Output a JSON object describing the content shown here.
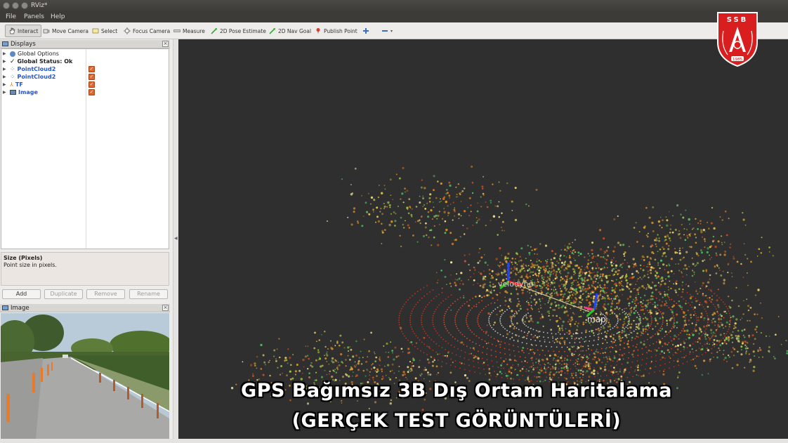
{
  "window": {
    "title": "RViz*"
  },
  "menu": {
    "items": [
      "File",
      "Panels",
      "Help"
    ]
  },
  "toolbar": {
    "tools": [
      {
        "label": "Interact",
        "icon": "hand-icon"
      },
      {
        "label": "Move Camera",
        "icon": "move-camera-icon"
      },
      {
        "label": "Select",
        "icon": "select-icon"
      },
      {
        "label": "Focus Camera",
        "icon": "focus-camera-icon"
      },
      {
        "label": "Measure",
        "icon": "ruler-icon"
      },
      {
        "label": "2D Pose Estimate",
        "icon": "green-arrow-icon"
      },
      {
        "label": "2D Nav Goal",
        "icon": "green-arrow-icon"
      },
      {
        "label": "Publish Point",
        "icon": "pin-icon"
      }
    ]
  },
  "displays_panel": {
    "title": "Displays",
    "items": [
      {
        "label": "Global Options",
        "style": "normal",
        "checked": false
      },
      {
        "label": "Global Status: Ok",
        "style": "bold",
        "checked": false
      },
      {
        "label": "PointCloud2",
        "style": "blue",
        "checked": true
      },
      {
        "label": "PointCloud2",
        "style": "blue",
        "checked": true
      },
      {
        "label": "TF",
        "style": "blue",
        "checked": true
      },
      {
        "label": "Image",
        "style": "blue",
        "checked": true
      }
    ]
  },
  "property": {
    "title": "Size (Pixels)",
    "description": "Point size in pixels."
  },
  "buttons": {
    "add": "Add",
    "duplicate": "Duplicate",
    "remove": "Remove",
    "rename": "Rename"
  },
  "image_panel": {
    "title": "Image"
  },
  "view3d": {
    "frame_labels": [
      "velodyne",
      "map"
    ]
  },
  "logo": {
    "text": "SSB",
    "year": "1985",
    "color": "#d81e1e"
  },
  "caption": {
    "line1": "GPS Bağımsız 3B Dış Ortam Haritalama",
    "line2": "(GERÇEK TEST GÖRÜNTÜLERİ)"
  }
}
